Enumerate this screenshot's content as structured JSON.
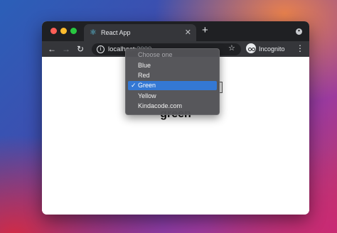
{
  "browser": {
    "tab_title": "React App",
    "tab_icon": "react-logo-icon",
    "close_glyph": "✕",
    "new_tab_glyph": "+",
    "menu_glyph": "▾",
    "url_host": "localhost",
    "url_port": ":3000",
    "info_glyph": "i",
    "profile_label": "Incognito",
    "back_glyph": "←",
    "forward_glyph": "→",
    "reload_glyph": "↻",
    "star_glyph": "☆",
    "kebab_glyph": "⋮"
  },
  "page": {
    "selected_value_text": "green"
  },
  "select": {
    "placeholder": "Choose one",
    "options": [
      {
        "label": "Blue"
      },
      {
        "label": "Red"
      },
      {
        "label": "Green",
        "checked": true
      },
      {
        "label": "Yellow"
      },
      {
        "label": "Kindacode.com"
      }
    ],
    "check_glyph": "✓"
  },
  "colors": {
    "highlight": "#3478d4",
    "tab_bar": "#1f2023",
    "toolbar": "#35363a"
  }
}
